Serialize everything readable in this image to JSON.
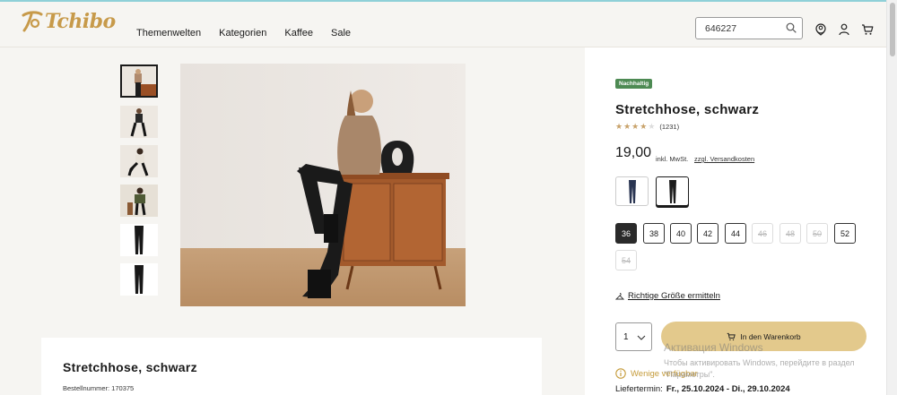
{
  "header": {
    "logo_text": "Tchibo",
    "nav": [
      "Themenwelten",
      "Kategorien",
      "Kaffee",
      "Sale"
    ],
    "search_value": "646227",
    "icons": [
      "search-icon",
      "location-icon",
      "account-icon",
      "cart-icon"
    ]
  },
  "gallery": {
    "thumbnail_count": 6,
    "active_index": 0
  },
  "product": {
    "badge": "Nachhaltig",
    "title": "Stretchhose, schwarz",
    "rating": 4.5,
    "rating_count": "(1231)",
    "price": "19,00",
    "vat": "inkl. MwSt.",
    "shipping": "zzgl. Versandkosten",
    "colors": [
      {
        "name": "navy",
        "hex": "#2a3552"
      },
      {
        "name": "schwarz",
        "hex": "#1c1c1c",
        "selected": true
      }
    ],
    "sizes": [
      {
        "label": "36",
        "state": "selected"
      },
      {
        "label": "38",
        "state": "available"
      },
      {
        "label": "40",
        "state": "available"
      },
      {
        "label": "42",
        "state": "available"
      },
      {
        "label": "44",
        "state": "available"
      },
      {
        "label": "46",
        "state": "disabled"
      },
      {
        "label": "48",
        "state": "disabled"
      },
      {
        "label": "50",
        "state": "disabled"
      },
      {
        "label": "52",
        "state": "available"
      },
      {
        "label": "54",
        "state": "disabled"
      }
    ],
    "size_finder": "Richtige Größe ermitteln",
    "quantity": "1",
    "cart_button": "In den Warenkorb",
    "availability": "Wenige verfügbar",
    "delivery_label": "Liefertermin:",
    "delivery_value": "Fr., 25.10.2024 - Di., 29.10.2024"
  },
  "info": {
    "title": "Stretchhose, schwarz",
    "order_number": "Bestellnummer: 170375"
  },
  "watermark": {
    "line1": "Активация Windows",
    "line2": "Чтобы активировать Windows, перейдите в раздел \"Параметры\"."
  },
  "colors": {
    "accent_gold": "#c79a4a",
    "cart_button": "#e3c98c",
    "badge_green": "#4d8a53",
    "availability": "#c59b3a"
  }
}
